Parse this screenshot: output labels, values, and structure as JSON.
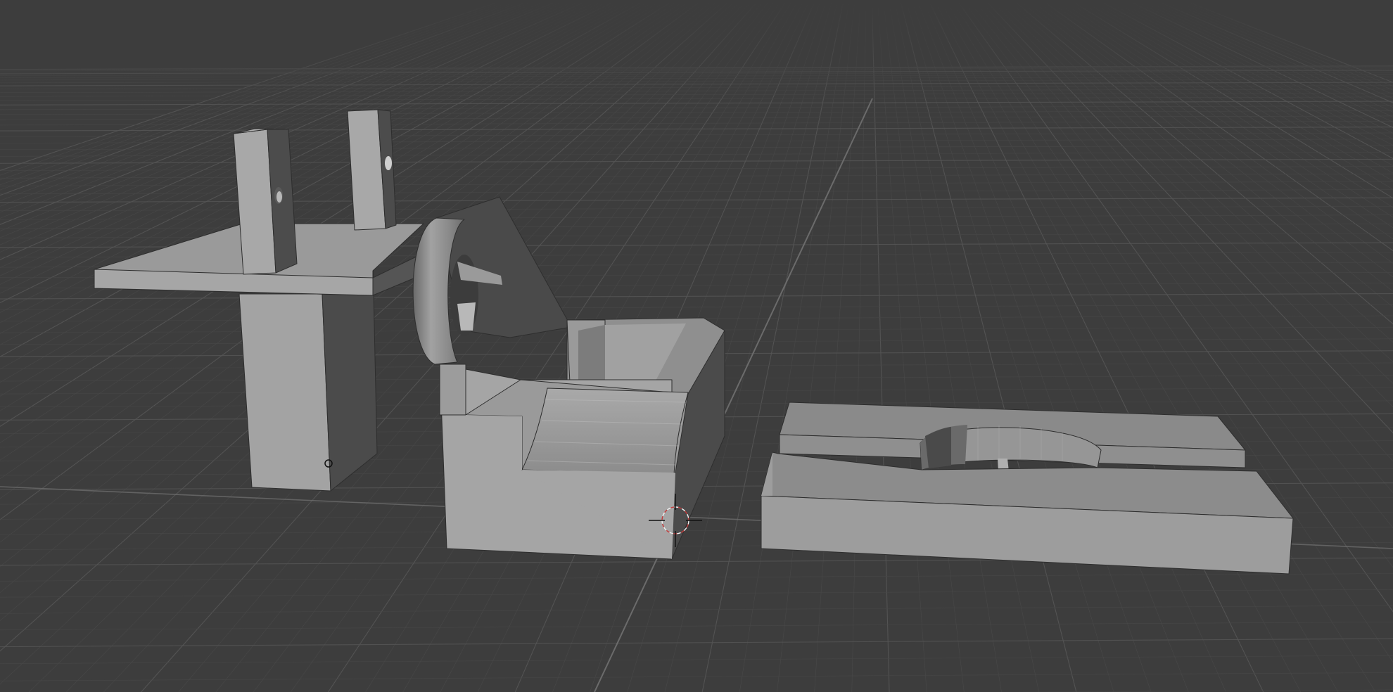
{
  "app": {
    "name": "",
    "view": "3d-viewport"
  },
  "theme": {
    "background": "#3d3d3d",
    "grid_minor": "#484848",
    "grid_major": "#555555",
    "axis_line": "#6b6b6b",
    "surface_light": "#a6a6a6",
    "surface_mid": "#8f8f8f",
    "surface_top": "#9a9a9a",
    "surface_dark": "#4b4b4b",
    "edge": "#2e2e2e"
  },
  "scene": {
    "objects": [
      {
        "id": "bracket-a",
        "label": "",
        "icon": "mesh-icon"
      },
      {
        "id": "bracket-b",
        "label": "",
        "icon": "mesh-icon"
      },
      {
        "id": "base-plate",
        "label": "",
        "icon": "mesh-icon"
      }
    ],
    "cursor_icon": "3d-cursor-icon",
    "origin_icon": "origin-point-icon"
  }
}
